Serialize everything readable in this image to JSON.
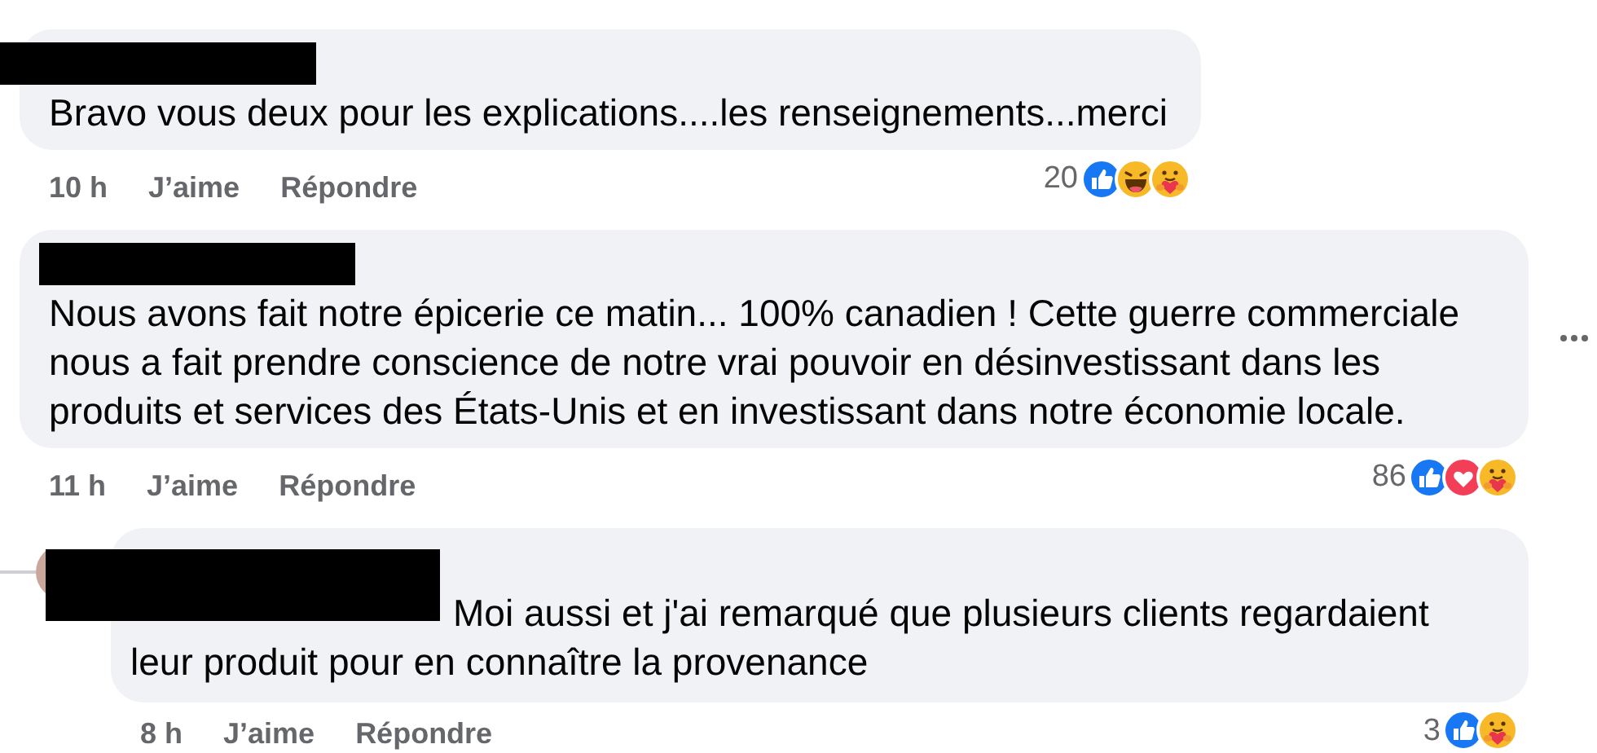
{
  "comments": [
    {
      "kind": "comment",
      "text": "Bravo vous deux pour les explications....les renseignements...merci",
      "time": "10 h",
      "like_label": "J’aime",
      "reply_label": "Répondre",
      "reaction_count": "20",
      "reactions": [
        {
          "kind": "like"
        },
        {
          "kind": "haha"
        },
        {
          "kind": "care"
        }
      ],
      "show_options": false
    },
    {
      "kind": "comment",
      "text": "Nous avons fait notre épicerie ce matin... 100% canadien ! Cette guerre commerciale nous a fait prendre conscience de notre vrai pouvoir en désinvestissant dans les produits et services des États-Unis et en investissant dans notre économie locale.",
      "time": "11 h",
      "like_label": "J’aime",
      "reply_label": "Répondre",
      "reaction_count": "86",
      "reactions": [
        {
          "kind": "like"
        },
        {
          "kind": "love"
        },
        {
          "kind": "care"
        }
      ],
      "show_options": true
    },
    {
      "kind": "reply",
      "text": "Moi aussi et j'ai remarqué que plusieurs clients regardaient leur produit pour en connaître la provenance",
      "time": "8 h",
      "like_label": "J’aime",
      "reply_label": "Répondre",
      "reaction_count": "3",
      "reactions": [
        {
          "kind": "like"
        },
        {
          "kind": "care"
        }
      ],
      "show_options": false
    }
  ]
}
